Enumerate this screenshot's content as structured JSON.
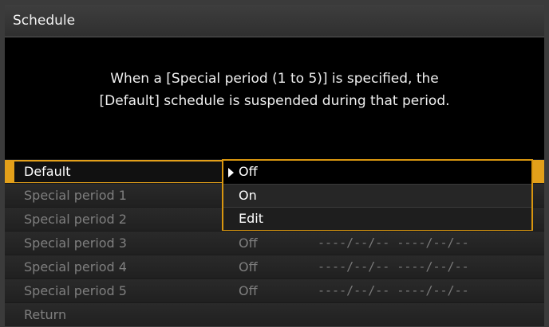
{
  "window": {
    "title": "Schedule"
  },
  "message": {
    "line1": "When a [Special period (1 to 5)] is specified, the",
    "line2": "[Default] schedule is suspended during that period."
  },
  "menu": {
    "rows": [
      {
        "label": "Default",
        "value": "",
        "dates": ""
      },
      {
        "label": "Special period 1",
        "value": "",
        "dates": ""
      },
      {
        "label": "Special period 2",
        "value": "",
        "dates": ""
      },
      {
        "label": "Special period 3",
        "value": "Off",
        "dates": "----/--/-- ----/--/--"
      },
      {
        "label": "Special period 4",
        "value": "Off",
        "dates": "----/--/-- ----/--/--"
      },
      {
        "label": "Special period 5",
        "value": "Off",
        "dates": "----/--/-- ----/--/--"
      },
      {
        "label": "Return",
        "value": "",
        "dates": ""
      }
    ]
  },
  "dropdown": {
    "options": [
      "Off",
      "On",
      "Edit"
    ],
    "selected": "Off"
  },
  "colors": {
    "accent": "#e3a01a",
    "background": "#000000",
    "text": "#ffffff",
    "disabled_text": "#7f7f7f"
  }
}
